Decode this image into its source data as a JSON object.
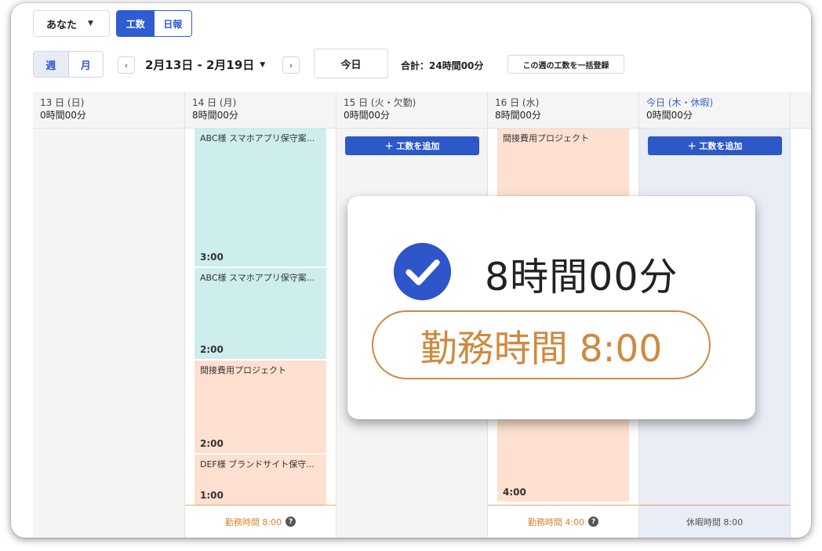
{
  "toolbar": {
    "user_select": "あなた",
    "mode_tabs": [
      "工数",
      "日報"
    ],
    "range_tabs": [
      "週",
      "月"
    ],
    "prev": "‹",
    "next": "›",
    "date_range": "2月13日 - 2月19日",
    "today": "今日",
    "total": "合計：24時間00分",
    "bulk_register": "この週の工数を一括登録"
  },
  "days": [
    {
      "date": "13 日 (日)",
      "total": "0時間00分"
    },
    {
      "date": "14 日 (月)",
      "total": "8時間00分",
      "entries": [
        {
          "title": "ABC様 スマホアプリ保守案...",
          "hours": "3:00"
        },
        {
          "title": "ABC様 スマホアプリ保守案...",
          "hours": "2:00"
        },
        {
          "title": "間接費用プロジェクト",
          "hours": "2:00"
        },
        {
          "title": "DEF様 ブランドサイト保守...",
          "hours": "1:00"
        }
      ],
      "footer": "勤務時間 8:00"
    },
    {
      "date": "15 日 (火・欠勤)",
      "total": "0時間00分",
      "add_label": "＋ 工数を追加"
    },
    {
      "date": "16 日 (水)",
      "total": "8時間00分",
      "entries": [
        {
          "title": "間接費用プロジェクト",
          "hours": "4:00"
        }
      ],
      "footer": "勤務時間 4:00"
    },
    {
      "date": "今日 (木・休暇)",
      "total": "0時間00分",
      "add_label": "＋ 工数を追加",
      "footer": "休暇時間 8:00"
    }
  ],
  "popup": {
    "hours": "8時間00分",
    "work_time": "勤務時間 8:00"
  },
  "colors": {
    "accent": "#2f5bd3",
    "teal_entry": "#cdeeed",
    "peach_entry": "#fde0cf",
    "work_time": "#cf8a3e"
  },
  "icons": {
    "help": "?",
    "check": "check-circle-icon"
  }
}
